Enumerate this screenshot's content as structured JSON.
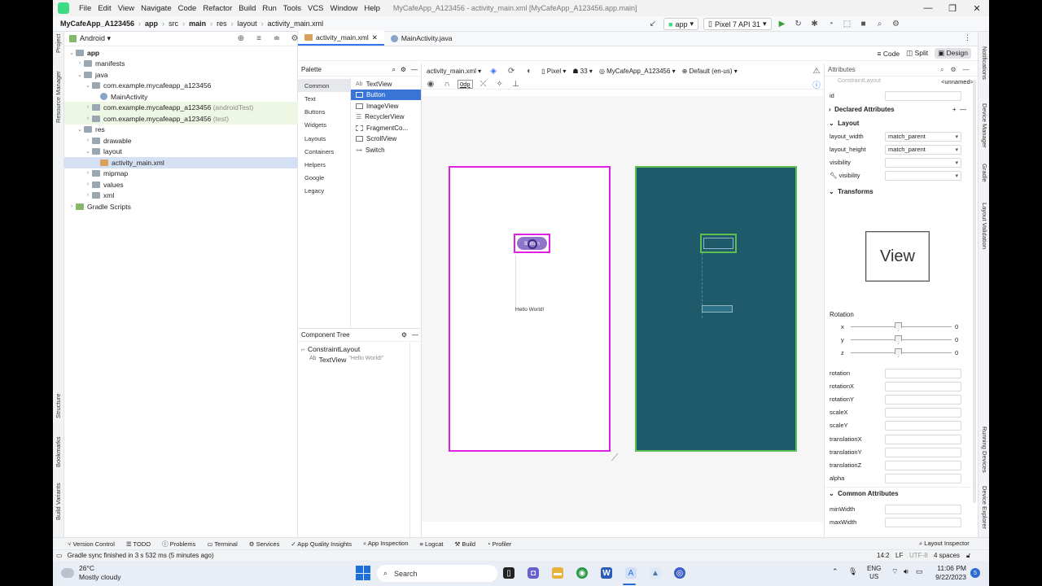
{
  "menubar": {
    "items": [
      "File",
      "Edit",
      "View",
      "Navigate",
      "Code",
      "Refactor",
      "Build",
      "Run",
      "Tools",
      "VCS",
      "Window",
      "Help"
    ],
    "window_title": "MyCafeApp_A123456 - activity_main.xml [MyCafeApp_A123456.app.main]"
  },
  "navbar": {
    "crumbs": [
      "MyCafeApp_A123456",
      "app",
      "src",
      "main",
      "res",
      "layout",
      "activity_main.xml"
    ],
    "run_config": "app",
    "device": "Pixel 7 API 31"
  },
  "side_tools_left": [
    "Project",
    "Resource Manager",
    "Structure",
    "Bookmarks",
    "Build Variants"
  ],
  "side_tools_right": [
    "Notifications",
    "Device Manager",
    "Gradle",
    "Layout Validation",
    "Running Devices",
    "Device Explorer"
  ],
  "project": {
    "view_label": "Android",
    "rows": [
      {
        "label": "app",
        "bold": true
      },
      {
        "label": "manifests"
      },
      {
        "label": "java"
      },
      {
        "label": "com.example.mycafeapp_a123456"
      },
      {
        "label": "MainActivity"
      },
      {
        "label": "com.example.mycafeapp_a123456",
        "suffix": "(androidTest)"
      },
      {
        "label": "com.example.mycafeapp_a123456",
        "suffix": "(test)"
      },
      {
        "label": "res"
      },
      {
        "label": "drawable"
      },
      {
        "label": "layout"
      },
      {
        "label": "activity_main.xml"
      },
      {
        "label": "mipmap"
      },
      {
        "label": "values"
      },
      {
        "label": "xml"
      },
      {
        "label": "Gradle Scripts"
      }
    ]
  },
  "editor": {
    "tabs": [
      "activity_main.xml",
      "MainActivity.java"
    ],
    "view_modes": [
      "Code",
      "Split",
      "Design"
    ]
  },
  "palette": {
    "title": "Palette",
    "categories": [
      "Common",
      "Text",
      "Buttons",
      "Widgets",
      "Layouts",
      "Containers",
      "Helpers",
      "Google",
      "Legacy"
    ],
    "items": [
      "TextView",
      "Button",
      "ImageView",
      "RecyclerView",
      "FragmentCo...",
      "ScrollView",
      "Switch"
    ]
  },
  "component_tree": {
    "title": "Component Tree",
    "root": "ConstraintLayout",
    "child": "TextView",
    "child_hint": "\"Hello World!\""
  },
  "design_toolbar": {
    "file": "activity_main.xml",
    "device": "Pixel",
    "api": "33",
    "theme": "MyCafeApp_A123456",
    "locale": "Default (en-us)",
    "margin": "0dp"
  },
  "preview": {
    "button_text": "Button",
    "hello_text": "Hello World!",
    "blueprint_color": "#1f5a6b",
    "design_border": "#e020e0",
    "blueprint_border": "#5cbf4f"
  },
  "attributes": {
    "title": "Attributes",
    "class": "ConstraintLayout",
    "unnamed": "<unnamed>",
    "id_label": "id",
    "declared": "Declared Attributes",
    "layout_section": "Layout",
    "layout_rows": [
      {
        "name": "layout_width",
        "value": "match_parent"
      },
      {
        "name": "layout_height",
        "value": "match_parent"
      },
      {
        "name": "visibility",
        "value": ""
      },
      {
        "name": "visibility",
        "value": ""
      }
    ],
    "transforms": "Transforms",
    "view_box": "View",
    "rotation": "Rotation",
    "rotation_axes": [
      {
        "axis": "x",
        "value": "0"
      },
      {
        "axis": "y",
        "value": "0"
      },
      {
        "axis": "z",
        "value": "0"
      }
    ],
    "transform_rows": [
      "rotation",
      "rotationX",
      "rotationY",
      "scaleX",
      "scaleY",
      "translationX",
      "translationY",
      "translationZ",
      "alpha"
    ],
    "common": "Common Attributes",
    "common_rows": [
      "minWidth",
      "maxWidth"
    ]
  },
  "bottom_tools": [
    "Version Control",
    "TODO",
    "Problems",
    "Terminal",
    "Services",
    "App Quality Insights",
    "App Inspection",
    "Logcat",
    "Build",
    "Profiler",
    "Layout Inspector"
  ],
  "status": {
    "message": "Gradle sync finished in 3 s 532 ms (5 minutes ago)",
    "position": "14:2",
    "line_ending": "LF",
    "encoding": "UTF-8",
    "indent": "4 spaces"
  },
  "taskbar": {
    "weather_temp": "26°C",
    "weather_desc": "Mostly cloudy",
    "search": "Search",
    "lang": "ENG",
    "region": "US",
    "time": "11:06 PM",
    "date": "9/22/2023",
    "badge": "5"
  }
}
